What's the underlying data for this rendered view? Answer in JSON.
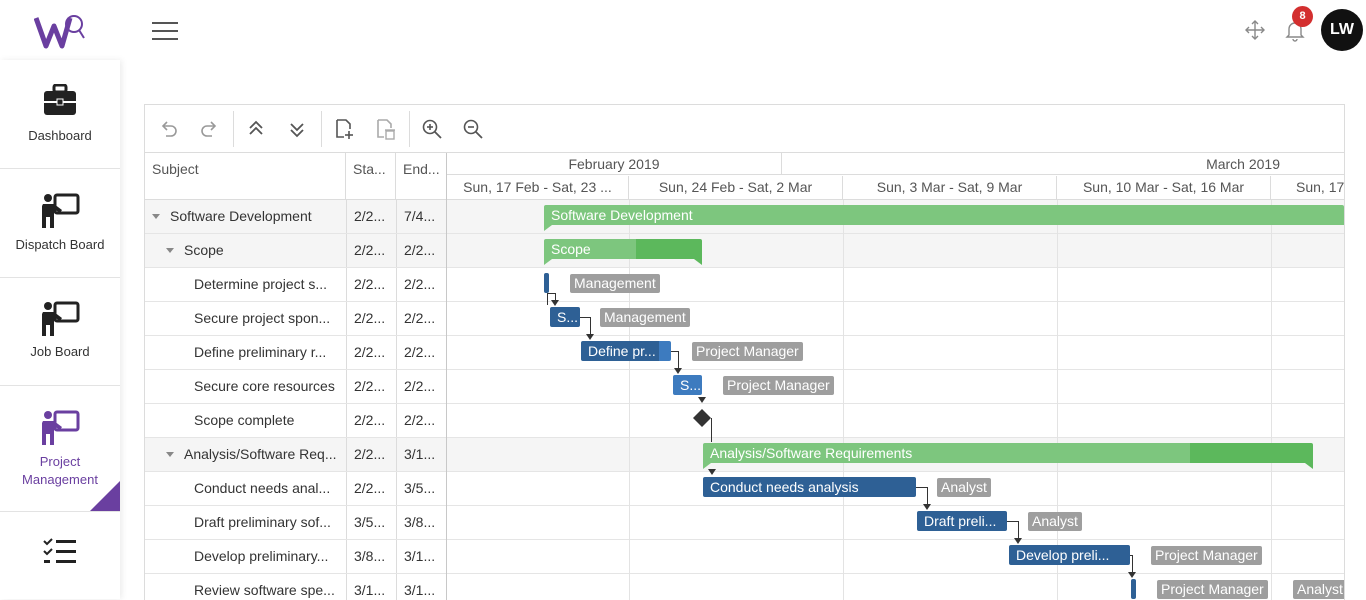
{
  "header": {
    "badge_count": "8",
    "avatar_initials": "LW"
  },
  "sidebar": {
    "items": [
      {
        "label": "Dashboard",
        "icon": "briefcase-icon"
      },
      {
        "label": "Dispatch Board",
        "icon": "presenter-board-icon"
      },
      {
        "label": "Job Board",
        "icon": "presenter-board-icon"
      },
      {
        "label": "Project Management",
        "icon": "presenter-board-icon",
        "active": true
      },
      {
        "label": "",
        "icon": "checklist-icon"
      }
    ],
    "accent": "#6a3fa0"
  },
  "gantt": {
    "columns": [
      "Subject",
      "Sta...",
      "End..."
    ],
    "months": [
      "February 2019",
      "March 2019"
    ],
    "weeks": [
      "Sun, 17 Feb - Sat, 23 ...",
      "Sun, 24 Feb - Sat, 2 Mar",
      "Sun, 3 Mar - Sat, 9 Mar",
      "Sun, 10 Mar - Sat, 16 Mar",
      "Sun, 17"
    ],
    "rows": [
      {
        "subject": "Software Development",
        "start": "2/2...",
        "end": "7/4..."
      },
      {
        "subject": "Scope",
        "start": "2/2...",
        "end": "2/2..."
      },
      {
        "subject": "Determine project s...",
        "start": "2/2...",
        "end": "2/2..."
      },
      {
        "subject": "Secure project spon...",
        "start": "2/2...",
        "end": "2/2..."
      },
      {
        "subject": "Define preliminary r...",
        "start": "2/2...",
        "end": "2/2..."
      },
      {
        "subject": "Secure core resources",
        "start": "2/2...",
        "end": "2/2..."
      },
      {
        "subject": "Scope complete",
        "start": "2/2...",
        "end": "2/2..."
      },
      {
        "subject": "Analysis/Software Req...",
        "start": "2/2...",
        "end": "3/1..."
      },
      {
        "subject": "Conduct needs anal...",
        "start": "2/2...",
        "end": "3/5..."
      },
      {
        "subject": "Draft preliminary sof...",
        "start": "3/5...",
        "end": "3/8..."
      },
      {
        "subject": "Develop preliminary...",
        "start": "3/8...",
        "end": "3/1..."
      },
      {
        "subject": "Review software spe...",
        "start": "3/1...",
        "end": "3/1..."
      }
    ],
    "bars": {
      "software_development": "Software Development",
      "scope": "Scope",
      "secure_project": "S...",
      "define_prelim": "Define pr...",
      "secure_core": "S...",
      "analysis": "Analysis/Software Requirements",
      "conduct": "Conduct needs analysis",
      "draft": "Draft preli...",
      "develop": "Develop preli..."
    },
    "resources": {
      "r_determine": "Management",
      "r_secure_project": "Management",
      "r_define": "Project Manager",
      "r_secure_core": "Project Manager",
      "r_conduct": "Analyst",
      "r_draft": "Analyst",
      "r_develop": "Project Manager",
      "r_review_1": "Project Manager",
      "r_review_2": "Analyst"
    },
    "colors": {
      "summary_bar": "#7dc67e",
      "summary_progress": "#5cb85c",
      "task_bar": "#2e6095",
      "resource_tag": "#9e9e9e"
    }
  }
}
